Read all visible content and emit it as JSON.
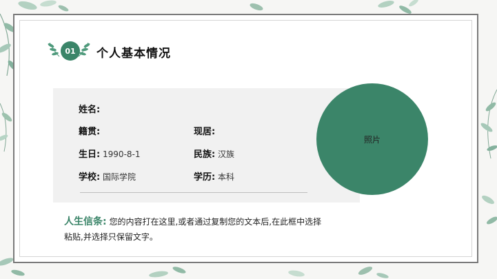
{
  "colors": {
    "accent": "#3b8569",
    "panel": "#f1f1f1",
    "frame": "#7a7a7a"
  },
  "section": {
    "number": "01",
    "title": "个人基本情况"
  },
  "fields": {
    "name": {
      "label": "姓名:",
      "value": ""
    },
    "native_place": {
      "label": "籍贯:",
      "value": ""
    },
    "residence": {
      "label": "现居:",
      "value": ""
    },
    "birthday": {
      "label": "生日:",
      "value": "1990-8-1"
    },
    "ethnicity": {
      "label": "民族:",
      "value": "汉族"
    },
    "school": {
      "label": "学校:",
      "value": "国际学院"
    },
    "education": {
      "label": "学历:",
      "value": "本科"
    }
  },
  "photo": {
    "label": "照片"
  },
  "motto": {
    "label": "人生信条:",
    "text": "您的内容打在这里,或者通过复制您的文本后,在此框中选择粘贴,并选择只保留文字。"
  },
  "decorations": {
    "icons": [
      "leaf-sprig-icon",
      "laurel-left-icon",
      "laurel-right-icon"
    ]
  }
}
